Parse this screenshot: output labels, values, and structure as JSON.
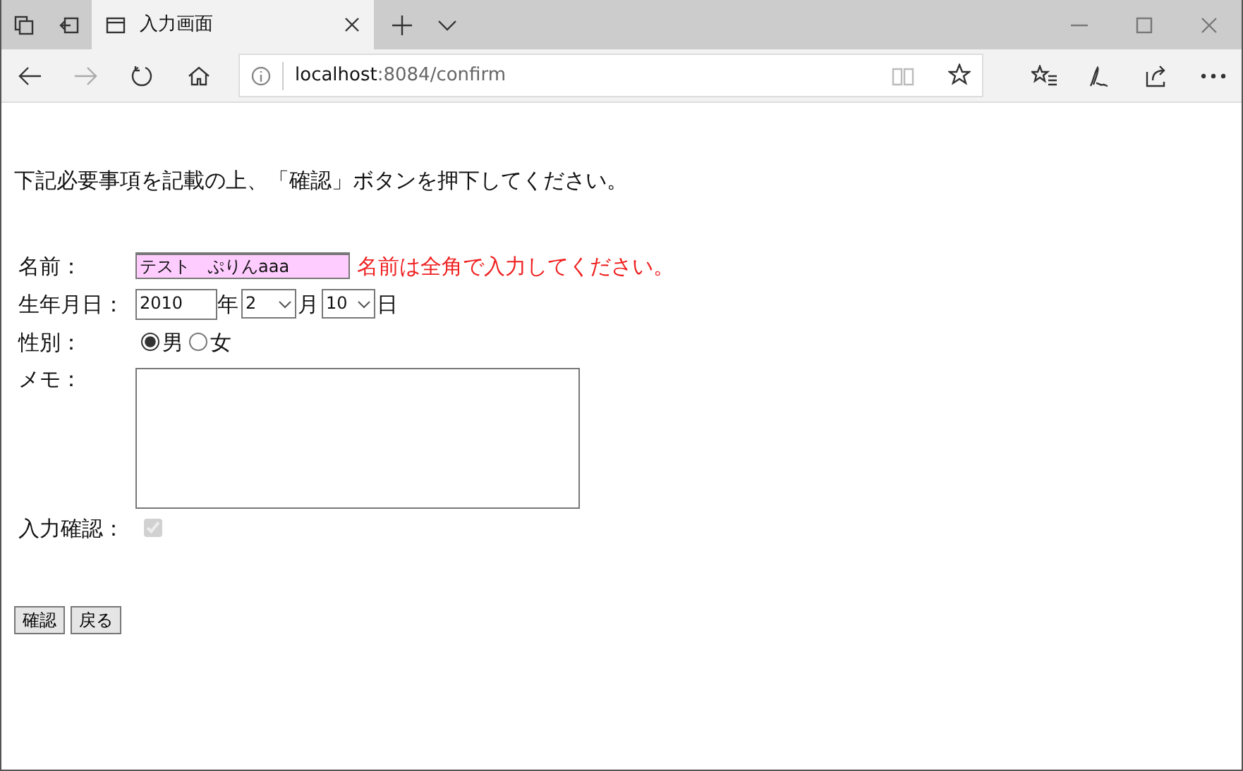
{
  "browser": {
    "tab_title": "入力画面",
    "url_host": "localhost",
    "url_rest": ":8084/confirm"
  },
  "page": {
    "instruction": "下記必要事項を記載の上、「確認」ボタンを押下してください。",
    "fields": [
      {
        "kind": "text",
        "label": "名前：",
        "value": "テスト　ぷりんaaa",
        "error": "名前は全角で入力してください。",
        "invalid": true
      },
      {
        "kind": "date",
        "label": "生年月日：",
        "year": "2010",
        "year_unit": "年",
        "month": "2",
        "month_unit": "月",
        "day": "10",
        "day_unit": "日"
      },
      {
        "kind": "radio",
        "label": "性別：",
        "options": [
          {
            "label": "男",
            "selected": true
          },
          {
            "label": "女",
            "selected": false
          }
        ]
      },
      {
        "kind": "textarea",
        "label": "メモ："
      },
      {
        "kind": "checkbox",
        "label": "入力確認：",
        "checked": true,
        "disabled": true
      }
    ],
    "buttons": [
      "確認",
      "戻る"
    ]
  }
}
